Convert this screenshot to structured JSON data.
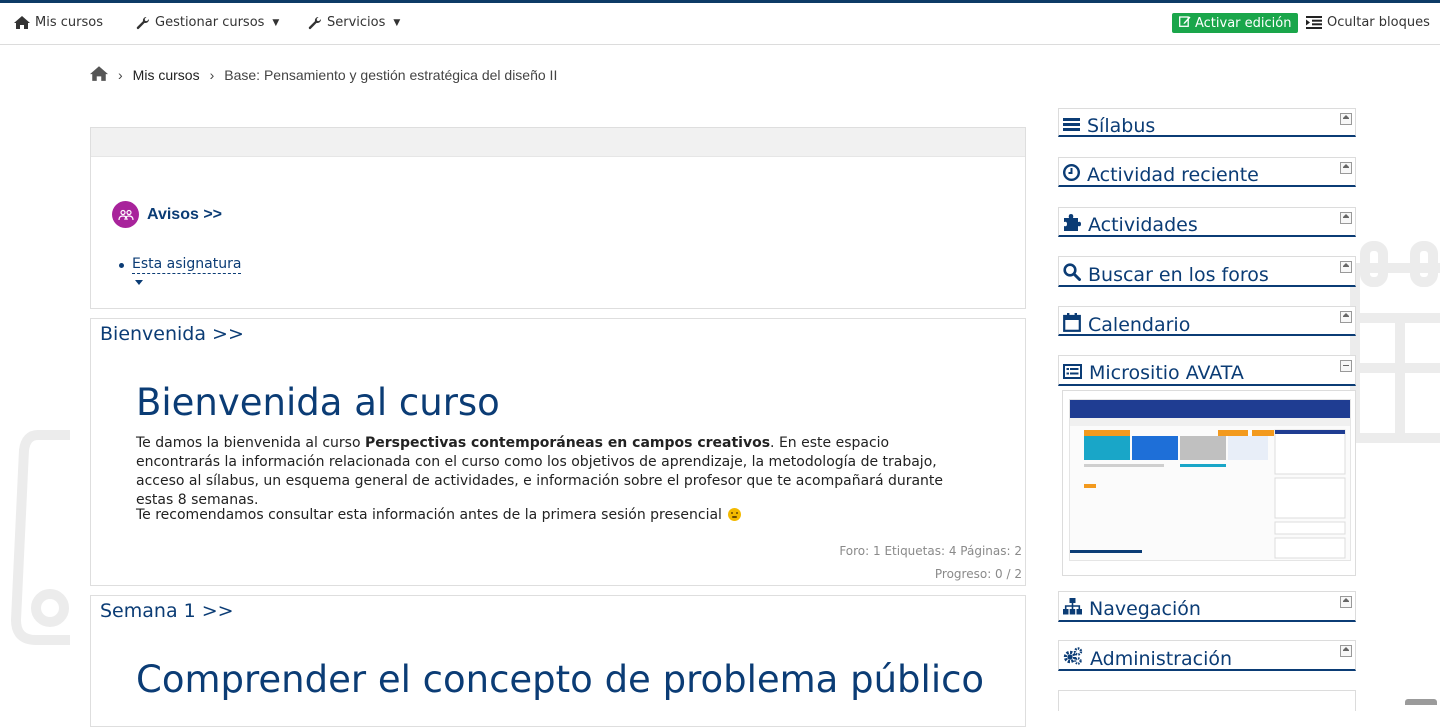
{
  "navbar": {
    "mis_cursos": "Mis cursos",
    "gestionar": "Gestionar cursos",
    "servicios": "Servicios",
    "activar": "Activar edición",
    "ocultar": "Ocultar bloques"
  },
  "breadcrumb": {
    "mis_cursos": "Mis cursos",
    "current": "Base: Pensamiento y gestión estratégica del diseño II"
  },
  "announce": {
    "avisos": "Avisos >>",
    "item": "Esta asignatura"
  },
  "bienvenida": {
    "title": "Bienvenida >>",
    "heading": "Bienvenida al curso",
    "p1_a": "Te damos la bienvenida al curso ",
    "p1_bold": "Perspectivas contemporáneas en campos creativos",
    "p1_b": ". En este espacio encontrarás la información relacionada con el curso como los objetivos de aprendizaje, la metodología de trabajo, acceso al sílabus, un esquema general de actividades, e información sobre el profesor que te acompañará durante estas 8 semanas.",
    "p2": "Te recomendamos consultar esta información antes de la primera sesión presencial",
    "stats": "Foro: 1  Etiquetas: 4  Páginas: 2",
    "progress": "Progreso: 0 / 2"
  },
  "semana1": {
    "title": "Semana 1 >>",
    "heading": "Comprender el concepto de problema público"
  },
  "blocks": [
    {
      "label": "Sílabus",
      "icon": "bars-icon"
    },
    {
      "label": "Actividad reciente",
      "icon": "clock-icon"
    },
    {
      "label": "Actividades",
      "icon": "puzzle-icon"
    },
    {
      "label": "Buscar en los foros",
      "icon": "search-icon"
    },
    {
      "label": "Calendario",
      "icon": "calendar-icon"
    },
    {
      "label": "Micrositio AVATA",
      "icon": "list-icon"
    },
    {
      "label": "Navegación",
      "icon": "sitemap-icon"
    },
    {
      "label": "Administración",
      "icon": "cogs-icon"
    }
  ],
  "colors": {
    "primary": "#0b3c75",
    "edit_button": "#1aa64b",
    "avisos_circle": "#a8239b"
  }
}
